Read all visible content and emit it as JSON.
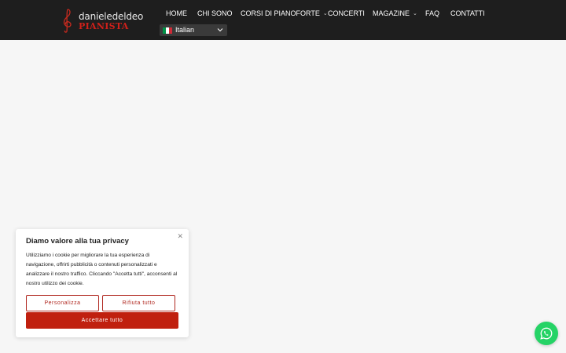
{
  "header": {
    "logo": {
      "line1": "danieledeldeo",
      "line2": "PIANISTA",
      "icon": "treble-clef-icon"
    },
    "nav": [
      {
        "label": "HOME",
        "dropdown": false
      },
      {
        "label": "CHI SONO",
        "dropdown": false
      },
      {
        "label": "CORSI DI PIANOFORTE",
        "dropdown": true
      },
      {
        "label": "CONCERTI",
        "dropdown": false
      },
      {
        "label": "MAGAZINE",
        "dropdown": true
      },
      {
        "label": "FAQ",
        "dropdown": false
      },
      {
        "label": "CONTATTI",
        "dropdown": false
      }
    ],
    "language": {
      "selected": "Italian",
      "flag_icon": "italy-flag-icon"
    }
  },
  "cookie_banner": {
    "title": "Diamo valore alla tua privacy",
    "text": "Utilizziamo i cookie per migliorare la tua esperienza di navigazione, offrirti pubblicità o contenuti personalizzati e analizzare il nostro traffico. Cliccando \"Accetta tutti\", acconsenti al nostro utilizzo dei cookie.",
    "close_icon": "close-icon",
    "customize_label": "Personalizza",
    "reject_label": "Rifiuta tutto",
    "accept_label": "Accettare tutto"
  },
  "floating": {
    "whatsapp_icon": "whatsapp-icon"
  },
  "colors": {
    "header_bg": "#1e1e1e",
    "accent_red": "#c0200f",
    "page_bg": "#f6f6f6",
    "whatsapp_green": "#25d366"
  }
}
